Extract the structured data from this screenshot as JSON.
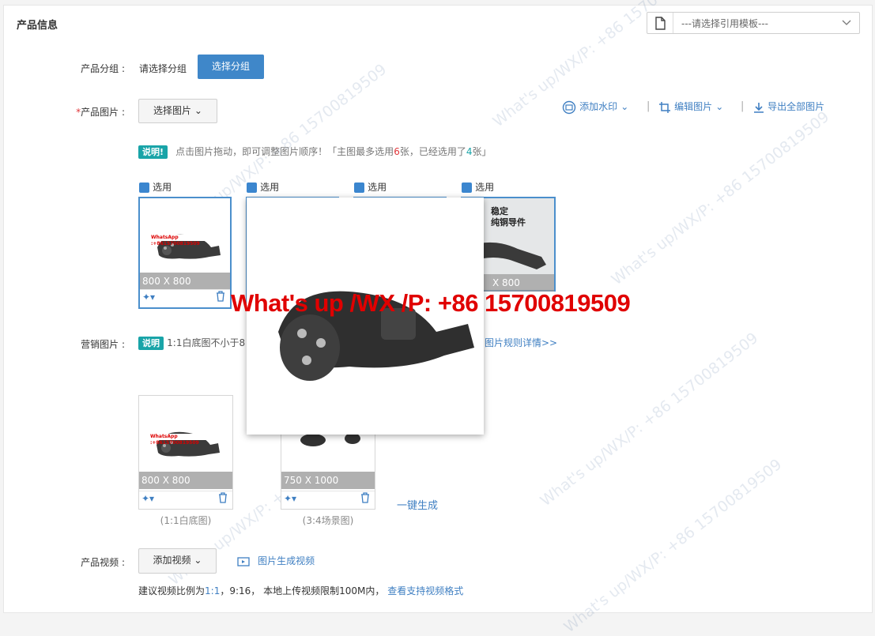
{
  "panel": {
    "title": "产品信息",
    "template_placeholder": "---请选择引用模板---"
  },
  "group": {
    "label": "产品分组 :",
    "value": "请选择分组",
    "button": "选择分组"
  },
  "product_images": {
    "required_mark": "*",
    "label": "产品图片 :",
    "select_button": "选择图片",
    "actions": {
      "watermark": "添加水印",
      "edit": "编辑图片",
      "export": "导出全部图片"
    },
    "tip_badge": "说明!",
    "tip_text_1": "点击图片拖动，即可调整图片顺序！「主图最多选用",
    "tip_max": "6",
    "tip_text_2": "张，已经选用了",
    "tip_used": "4",
    "tip_text_3": "张」",
    "select_label": "选用",
    "cards": [
      {
        "size": "800 X 800",
        "banner": "WhatsApp :+8615700819509"
      },
      {
        "size": ""
      },
      {
        "size": ""
      },
      {
        "size": "X 800",
        "text1": "稳定",
        "text2": "纯铜导件"
      }
    ]
  },
  "marketing": {
    "label": "营销图片 :",
    "badge": "说明",
    "text": "1:1白底图不小于8",
    "rules_link": "图片规则详情>>",
    "cards": [
      {
        "size": "800 X 800",
        "banner": "WhatsApp :+8615700819509",
        "caption": "(1:1白底图)"
      },
      {
        "size": "750 X 1000",
        "caption": "(3:4场景图)"
      }
    ],
    "generate_link": "一键生成"
  },
  "video": {
    "label": "产品视频 :",
    "add_button": "添加视频",
    "generate_link": "图片生成视频",
    "note_1": "建议视频比例为",
    "note_ratio_a": "1:1",
    "note_2": "，9:16， 本地上传视频限制100M内，",
    "formats_link": "查看支持视频格式"
  },
  "overlay": {
    "watermark": "What's up /WX /P: +86 15700819509"
  },
  "watermark_text": "What's up/WX/P: +86 15700819509",
  "colors": {
    "primary": "#3f87c9",
    "badge": "#19a4a8",
    "link": "#3f7fc2",
    "required": "#e0373b",
    "watermark": "#e00000"
  }
}
